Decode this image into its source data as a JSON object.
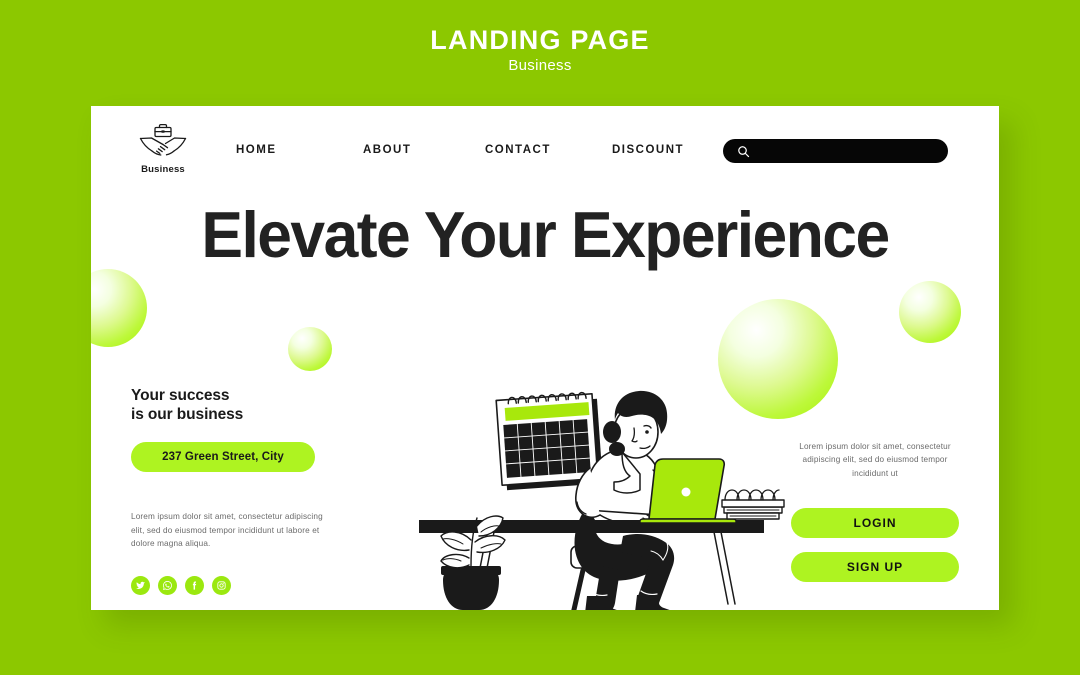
{
  "header": {
    "title": "LANDING PAGE",
    "subtitle": "Business"
  },
  "colors": {
    "background_green": "#8CC800",
    "accent_green": "#AEF321",
    "social_green": "#9BE80F",
    "card_white": "#FFFFFF",
    "text_dark": "#1A1A1A",
    "text_muted": "#6B6B6B",
    "search_black": "#060606"
  },
  "nav": {
    "logo": {
      "icon": "handshake-briefcase-icon",
      "label": "Business"
    },
    "links": [
      {
        "label": "HOME"
      },
      {
        "label": "ABOUT"
      },
      {
        "label": "CONTACT"
      },
      {
        "label": "DISCOUNT"
      }
    ],
    "search": {
      "icon": "search-icon",
      "value": "",
      "placeholder": ""
    }
  },
  "hero": {
    "headline": "Elevate Your Experience"
  },
  "left_column": {
    "tagline_line1": "Your success",
    "tagline_line2": "is our business",
    "address": "237 Green Street, City",
    "paragraph": "Lorem ipsum dolor sit amet, consectetur adipiscing elit, sed do eiusmod tempor incididunt ut labore et dolore magna aliqua.",
    "socials": [
      {
        "name": "twitter-icon"
      },
      {
        "name": "whatsapp-icon"
      },
      {
        "name": "facebook-icon"
      },
      {
        "name": "instagram-icon"
      }
    ]
  },
  "right_column": {
    "paragraph": "Lorem ipsum dolor sit amet, consectetur adipiscing elit, sed do eiusmod tempor incididunt ut",
    "login_label": "LOGIN",
    "signup_label": "SIGN UP"
  },
  "illustration": {
    "description": "Woman working at desk on laptop",
    "elements": [
      "wall-calendar",
      "woman-at-desk",
      "green-laptop",
      "book-stack",
      "desk",
      "chair",
      "potted-plant"
    ]
  }
}
